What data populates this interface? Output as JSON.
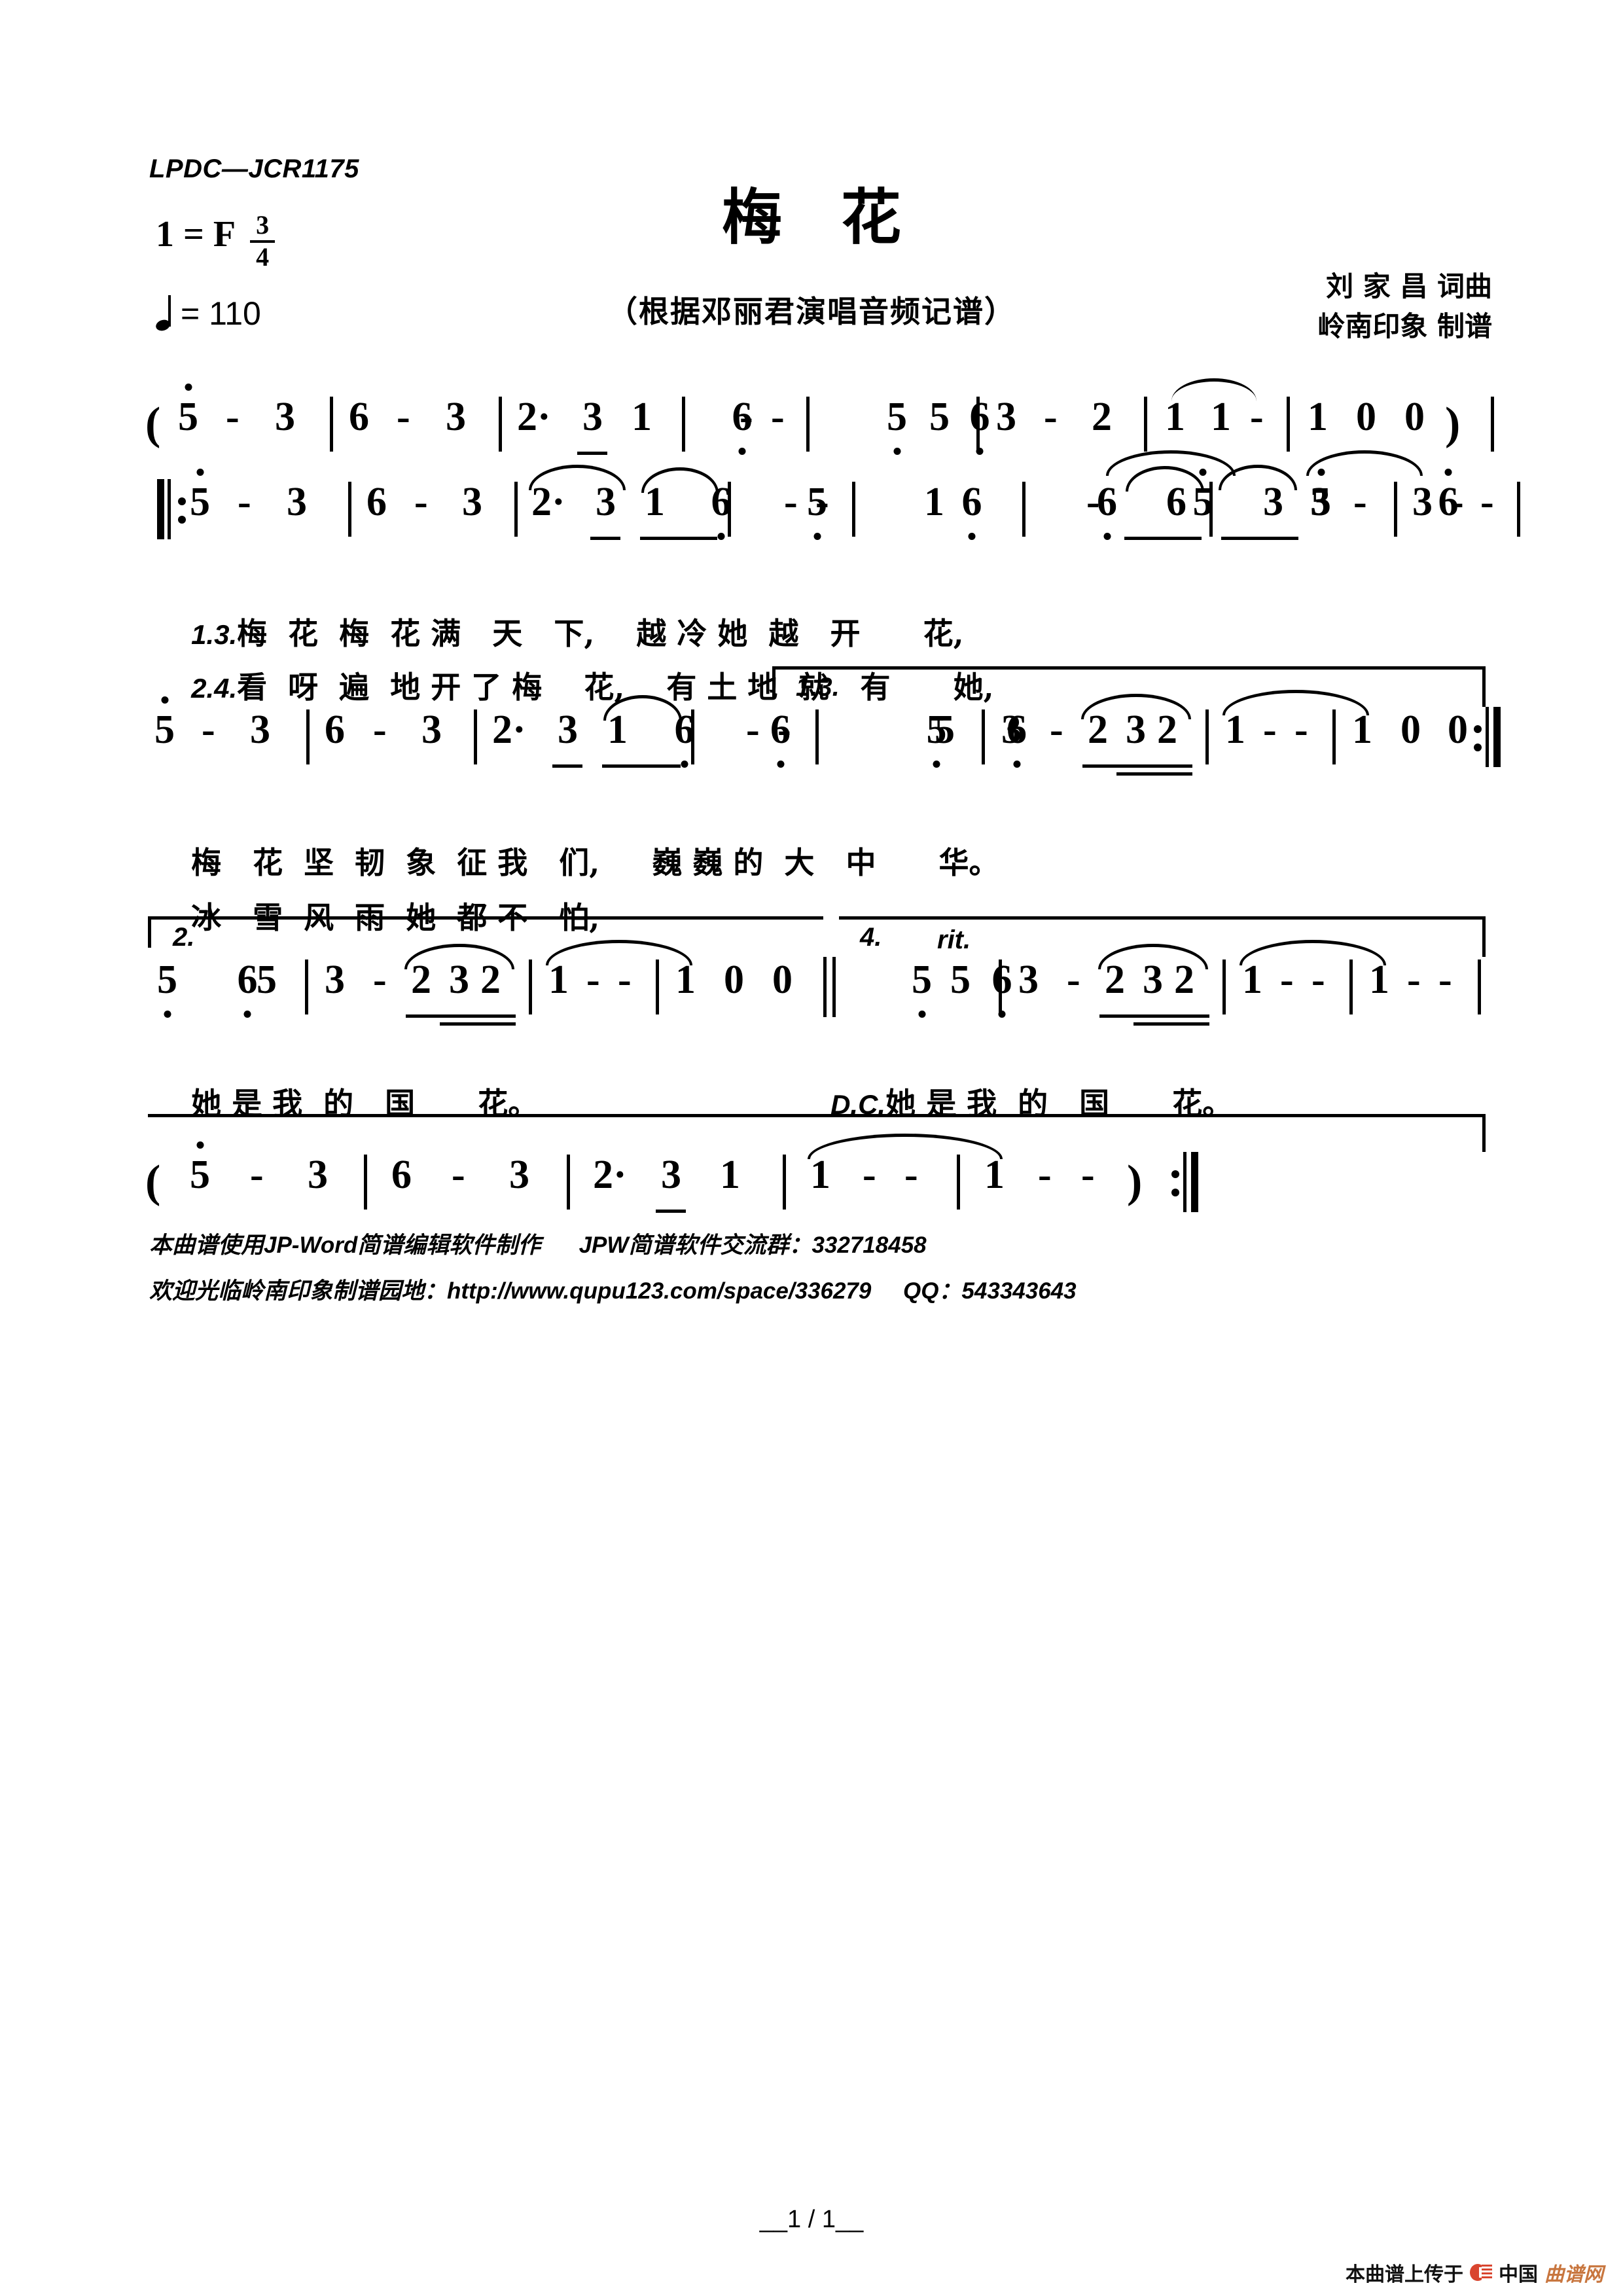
{
  "header": {
    "catalog": "LPDC—JCR1175",
    "key_label": "1 = F",
    "meter_num": "3",
    "meter_den": "4",
    "tempo_label": "= 110",
    "title": "梅花",
    "subtitle": "（根据邓丽君演唱音频记谱）",
    "credit_1": "刘 家 昌 词曲",
    "credit_2": "岭南印象 制谱"
  },
  "score": {
    "line1": {
      "open_paren": "(",
      "close_paren": ")",
      "notes": [
        "5",
        "-",
        "3",
        "6",
        "-",
        "3",
        "2·",
        "3",
        "1",
        "6",
        "-",
        "-",
        "5",
        "6",
        "5",
        "3",
        "-",
        "2",
        "1",
        "1",
        "-",
        "1",
        "0",
        "0"
      ]
    },
    "line2": {
      "notes": [
        "5",
        "-",
        "3",
        "6",
        "-",
        "3",
        "2·",
        "3",
        "1",
        "6",
        "5",
        "-",
        "-",
        "6",
        "1",
        "6",
        "5",
        "-",
        "5",
        "6",
        "6",
        "3",
        "3",
        "-",
        "3",
        "-",
        "-"
      ]
    },
    "line3": {
      "volta_label": "1.3.",
      "notes": [
        "5",
        "-",
        "3",
        "6",
        "-",
        "3",
        "2·",
        "3",
        "1",
        "6",
        "6",
        "-",
        "-",
        "5",
        "6",
        "5",
        "3",
        "-",
        "2",
        "3",
        "2",
        "1",
        "-",
        "-",
        "1",
        "0",
        "0"
      ]
    },
    "line4": {
      "volta_label_a": "2.",
      "volta_label_b": "4.",
      "rit": "rit.",
      "notes_a": [
        "5",
        "6",
        "5",
        "3",
        "-",
        "2",
        "3",
        "2",
        "1",
        "-",
        "-",
        "1",
        "0",
        "0"
      ],
      "notes_b": [
        "5",
        "6",
        "5",
        "3",
        "-",
        "2",
        "3",
        "2",
        "1",
        "-",
        "-",
        "1",
        "-",
        "-"
      ]
    },
    "line5": {
      "open_paren": "(",
      "close_paren": ")",
      "notes": [
        "5",
        "-",
        "3",
        "6",
        "-",
        "3",
        "2·",
        "3",
        "1",
        "1",
        "-",
        "-",
        "1",
        "-",
        "-"
      ]
    }
  },
  "lyrics": {
    "l2a_num": "1.3.",
    "l2a": "梅  花  梅  花 满   天   下,    越 冷 她  越   开      花,",
    "l2b_num": "2.4.",
    "l2b": "看  呀  遍  地 开 了 梅    花,    有 土 地  就   有      她,",
    "l3a": "梅   花  坚  韧  象  征 我   们,     巍 巍 的  大   中      华。",
    "l3b": "冰   雪  风  雨  她  都 不   怕,",
    "l4a": "她 是 我  的   国      花。",
    "l4b_dc": "D.C.",
    "l4b": "她 是 我  的   国      花。"
  },
  "footer": {
    "line1": "本曲谱使用JP-Word简谱编辑软件制作      JPW简谱软件交流群：332718458",
    "line2": "欢迎光临岭南印象制谱园地：http://www.qupu123.com/space/336279     QQ：543343643",
    "page_number": "__1 / 1__",
    "watermark_text": "本曲谱上传于",
    "watermark_brand_cn": "中国",
    "watermark_brand_or": "曲谱网"
  }
}
